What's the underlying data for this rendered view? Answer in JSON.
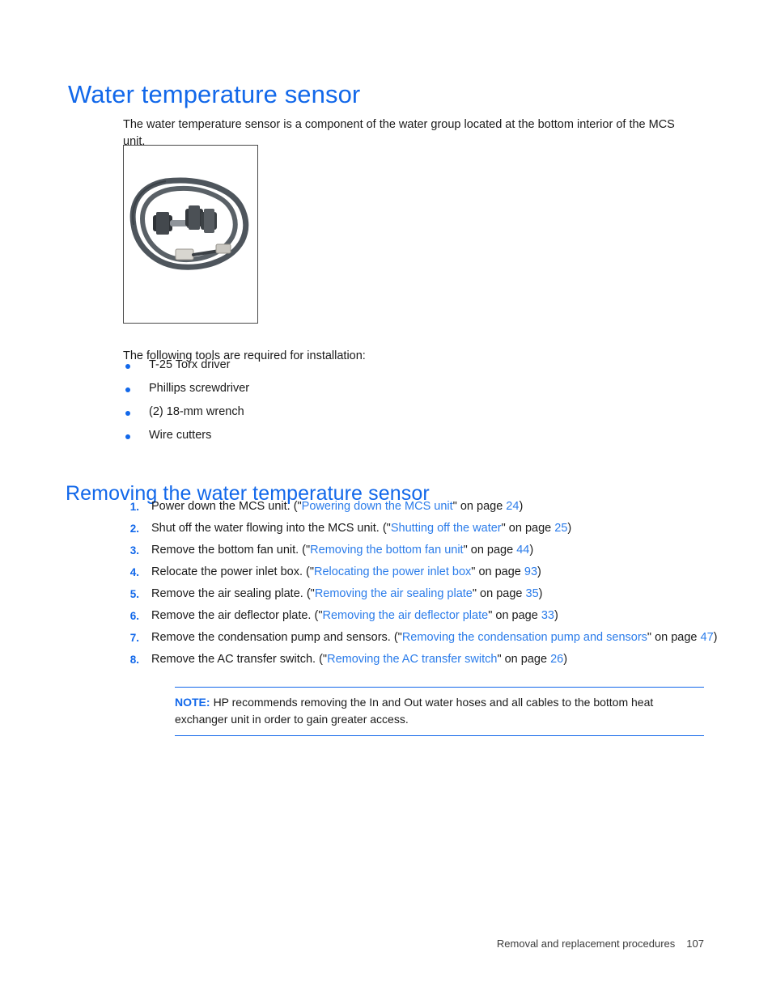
{
  "document": {
    "page_number": "107",
    "footer_text": "Removal and replacement procedures"
  },
  "headings": {
    "h1": "Water temperature sensor",
    "h2": "Removing the water temperature sensor"
  },
  "intro_paragraph": "The water temperature sensor is a component of the water group located at the bottom interior of the MCS unit.",
  "figure": {
    "alt": "water-temperature-sensor-photo"
  },
  "tools": {
    "lead": "The following tools are required for installation:",
    "items": [
      "T-25 Torx driver",
      "Phillips screwdriver",
      "(2) 18-mm wrench",
      "Wire cutters"
    ]
  },
  "steps": [
    {
      "num": "1.",
      "pre": "Power down the MCS unit. (\"",
      "link": "Powering down the MCS unit",
      "mid": "\" on page ",
      "page": "24",
      "post": ")"
    },
    {
      "num": "2.",
      "pre": "Shut off the water flowing into the MCS unit. (\"",
      "link": "Shutting off the water",
      "mid": "\" on page ",
      "page": "25",
      "post": ")"
    },
    {
      "num": "3.",
      "pre": "Remove the bottom fan unit. (\"",
      "link": "Removing the bottom fan unit",
      "mid": "\" on page ",
      "page": "44",
      "post": ")"
    },
    {
      "num": "4.",
      "pre": "Relocate the power inlet box. (\"",
      "link": "Relocating the power inlet box",
      "mid": "\" on page ",
      "page": "93",
      "post": ")"
    },
    {
      "num": "5.",
      "pre": "Remove the air sealing plate. (\"",
      "link": "Removing the air sealing plate",
      "mid": "\" on page ",
      "page": "35",
      "post": ")"
    },
    {
      "num": "6.",
      "pre": "Remove the air deflector plate. (\"",
      "link": "Removing the air deflector plate",
      "mid": "\" on page ",
      "page": "33",
      "post": ")"
    },
    {
      "num": "7.",
      "pre": "Remove the condensation pump and sensors. (\"",
      "link": "Removing the condensation pump and sensors",
      "mid": "\" on page ",
      "page": "47",
      "post": ")"
    },
    {
      "num": "8.",
      "pre": "Remove the AC transfer switch. (\"",
      "link": "Removing the AC transfer switch",
      "mid": "\" on page ",
      "page": "26",
      "post": ")"
    }
  ],
  "note": {
    "label": "NOTE:",
    "text": "HP recommends removing the In and Out water hoses and all cables to the bottom heat exchanger unit in order to gain greater access."
  },
  "colors": {
    "heading_blue": "#1268ea",
    "link_blue": "#2b7cea",
    "body_text": "#1a1a1a",
    "note_rule": "#1268ea",
    "figure_border": "#4a4a4a"
  }
}
